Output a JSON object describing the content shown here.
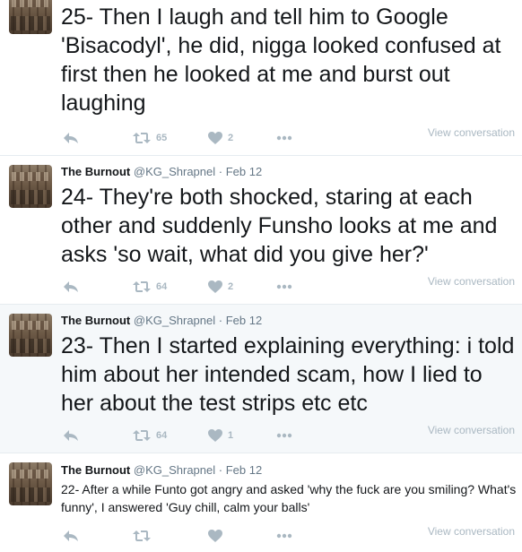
{
  "tweets": [
    {
      "text": "25- Then I laugh and tell him to Google 'Bisacodyl', he did, nigga looked confused at first then he looked at me and burst out laughing",
      "retweets": "65",
      "likes": "2",
      "view_conversation": "View conversation"
    },
    {
      "fullname": "The Burnout",
      "username": "@KG_Shrapnel",
      "sep": "·",
      "date": "Feb 12",
      "text": "24- They're both shocked, staring at each other and suddenly Funsho looks at me and asks 'so wait, what did you give her?'",
      "retweets": "64",
      "likes": "2",
      "view_conversation": "View conversation"
    },
    {
      "fullname": "The Burnout",
      "username": "@KG_Shrapnel",
      "sep": "·",
      "date": "Feb 12",
      "text": "23- Then I started explaining everything: i told him about her intended scam, how I lied to her about the test strips etc etc",
      "retweets": "64",
      "likes": "1",
      "view_conversation": "View conversation"
    },
    {
      "fullname": "The Burnout",
      "username": "@KG_Shrapnel",
      "sep": "·",
      "date": "Feb 12",
      "text": "22- After a while Funto got angry and asked 'why the fuck are you smiling? What's funny', I answered 'Guy chill, calm your balls'",
      "retweets": "",
      "likes": "",
      "view_conversation": "View conversation"
    }
  ],
  "icons": {
    "reply": "reply-icon",
    "retweet": "retweet-icon",
    "like": "heart-icon",
    "more": "more-icon"
  },
  "colors": {
    "text": "#14171a",
    "meta": "#657786",
    "action_icon": "#aab8c2",
    "highlight_bg": "#f5f8fa",
    "divider": "#e6ecf0"
  }
}
